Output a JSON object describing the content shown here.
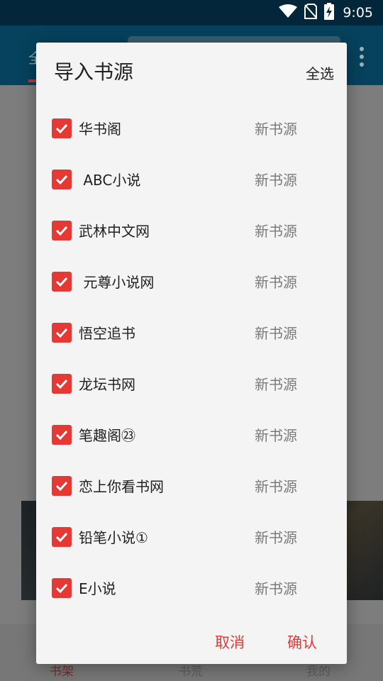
{
  "status_bar": {
    "time": "9:05",
    "icons": [
      "wifi-icon",
      "no-sim-icon",
      "battery-charging-icon"
    ]
  },
  "background": {
    "tab_label": "全",
    "bottom_nav": [
      "书架",
      "书荒",
      "我的"
    ],
    "colors": {
      "toolbar": "#06425d",
      "accent": "#b53a36"
    }
  },
  "dialog": {
    "title": "导入书源",
    "select_all": "全选",
    "sources": [
      {
        "name": "华书阁",
        "status": "新书源",
        "checked": true
      },
      {
        "name": " ABC小说",
        "status": "新书源",
        "checked": true
      },
      {
        "name": "武林中文网",
        "status": "新书源",
        "checked": true
      },
      {
        "name": " 元尊小说网",
        "status": "新书源",
        "checked": true
      },
      {
        "name": "悟空追书",
        "status": "新书源",
        "checked": true
      },
      {
        "name": "龙坛书网",
        "status": "新书源",
        "checked": true
      },
      {
        "name": "笔趣阁㉓",
        "status": "新书源",
        "checked": true
      },
      {
        "name": "恋上你看书网",
        "status": "新书源",
        "checked": true
      },
      {
        "name": "铅笔小说①",
        "status": "新书源",
        "checked": true
      },
      {
        "name": "E小说",
        "status": "新书源",
        "checked": true
      }
    ],
    "cancel_label": "取消",
    "confirm_label": "确认",
    "colors": {
      "accent": "#e53935",
      "surface": "#f4f4f4"
    }
  }
}
